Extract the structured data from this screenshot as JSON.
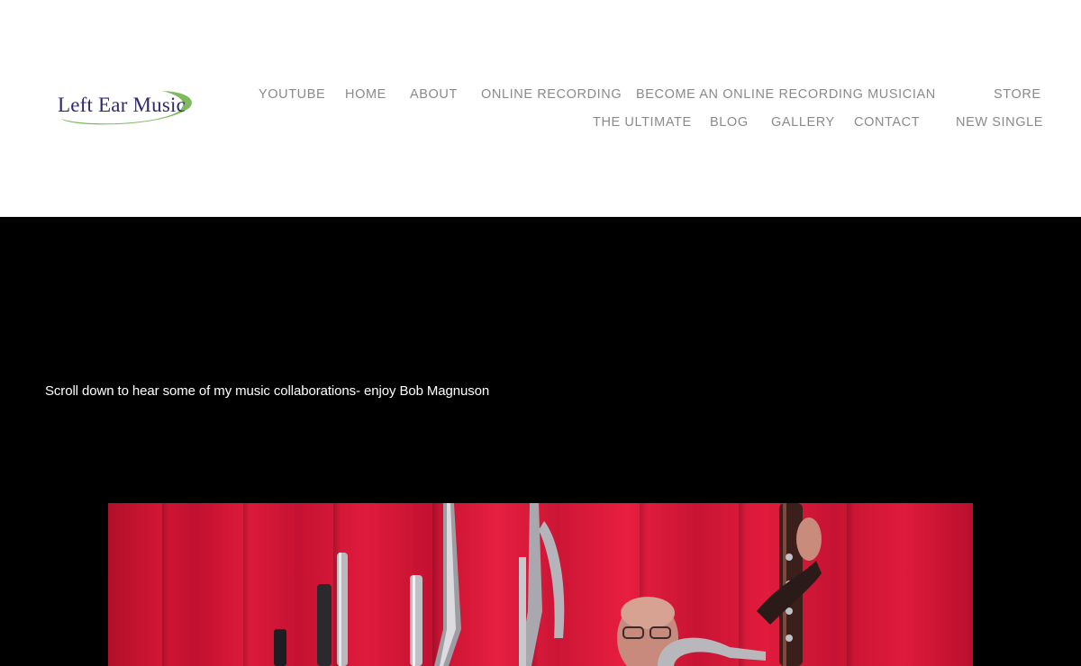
{
  "site": {
    "logo_text": "Left Ear Music"
  },
  "nav": {
    "row1": [
      "YOUTUBE",
      "HOME",
      "ABOUT",
      "ONLINE RECORDING",
      "BECOME AN ONLINE RECORDING MUSICIAN",
      "STORE"
    ],
    "row2": [
      "THE ULTIMATE",
      "BLOG",
      "GALLERY",
      "CONTACT",
      "NEW SINGLE"
    ]
  },
  "hero": {
    "text": "Scroll down to hear some of my music collaborations- enjoy Bob Magnuson"
  },
  "colors": {
    "nav_text": "#8a8a8a",
    "logo_text": "#2d2a6e",
    "logo_swoosh": "#7dba5e",
    "hero_bg": "#000000",
    "curtain": "#d21634"
  }
}
